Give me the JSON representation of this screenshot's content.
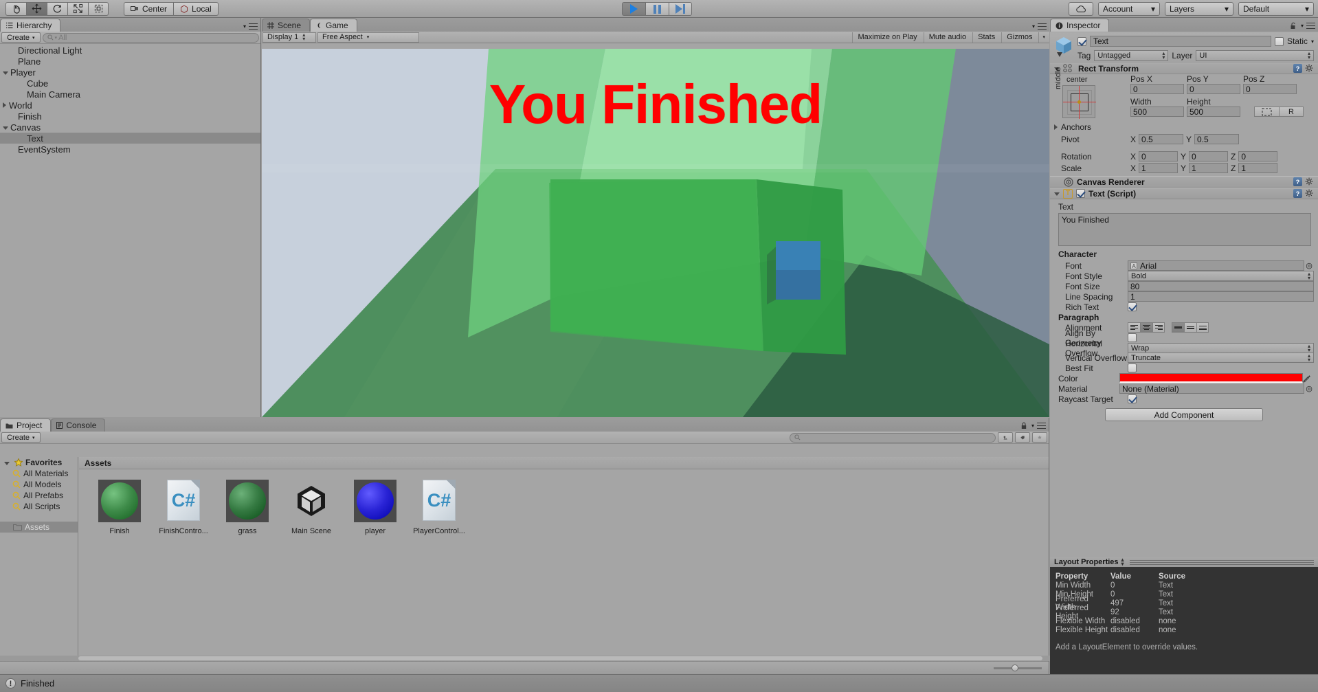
{
  "toolbar": {
    "tools": [
      {
        "name": "hand-tool",
        "icon": "hand",
        "active": false
      },
      {
        "name": "move-tool",
        "icon": "move",
        "active": true
      },
      {
        "name": "rotate-tool",
        "icon": "rotate",
        "active": false
      },
      {
        "name": "scale-tool",
        "icon": "scale",
        "active": false
      },
      {
        "name": "rect-tool",
        "icon": "rect",
        "active": false
      }
    ],
    "pivot_mode": "Center",
    "pivot_rotation": "Local",
    "play_label": "play",
    "pause_label": "pause",
    "step_label": "step",
    "cloud_label": "cloud",
    "account": "Account",
    "layers": "Layers",
    "layout": "Default"
  },
  "hierarchy": {
    "tab": "Hierarchy",
    "create_label": "Create",
    "search_placeholder": "All",
    "items": [
      {
        "label": "Directional Light",
        "depth": 1,
        "fold": "none",
        "selected": false
      },
      {
        "label": "Plane",
        "depth": 1,
        "fold": "none",
        "selected": false
      },
      {
        "label": "Player",
        "depth": 0,
        "fold": "down",
        "selected": false
      },
      {
        "label": "Cube",
        "depth": 2,
        "fold": "none",
        "selected": false
      },
      {
        "label": "Main Camera",
        "depth": 2,
        "fold": "none",
        "selected": false
      },
      {
        "label": "World",
        "depth": 0,
        "fold": "right",
        "selected": false
      },
      {
        "label": "Finish",
        "depth": 1,
        "fold": "none",
        "selected": false
      },
      {
        "label": "Canvas",
        "depth": 0,
        "fold": "down",
        "selected": false
      },
      {
        "label": "Text",
        "depth": 2,
        "fold": "none",
        "selected": true
      },
      {
        "label": "EventSystem",
        "depth": 1,
        "fold": "none",
        "selected": false
      }
    ]
  },
  "game": {
    "scene_tab": "Scene",
    "game_tab": "Game",
    "display": "Display 1",
    "aspect": "Free Aspect",
    "maximize_on_play": "Maximize on Play",
    "mute_audio": "Mute audio",
    "stats": "Stats",
    "gizmos": "Gizmos",
    "overlay_text": "You Finished",
    "overlay_color": "#ff0000",
    "sky_left_color": "#c7d0dc",
    "sky_right_color": "#7d8a9a",
    "ground_color": "#4e8f5e",
    "goal_color": "#3fae51",
    "player_color": "#3a7fbf"
  },
  "project": {
    "tab": "Project",
    "console_tab": "Console",
    "create_label": "Create",
    "search_placeholder": "",
    "favorites_label": "Favorites",
    "favorites": [
      "All Materials",
      "All Models",
      "All Prefabs",
      "All Scripts"
    ],
    "assets_root": "Assets",
    "breadcrumb": "Assets",
    "assets": [
      {
        "name": "Finish",
        "type": "material",
        "color": "#3f8c4a"
      },
      {
        "name": "FinishContro...",
        "type": "script"
      },
      {
        "name": "grass",
        "type": "material",
        "color": "#357a42"
      },
      {
        "name": "Main Scene",
        "type": "scene"
      },
      {
        "name": "player",
        "type": "material",
        "color": "#2a24d6"
      },
      {
        "name": "PlayerControl...",
        "type": "script"
      }
    ]
  },
  "inspector": {
    "tab": "Inspector",
    "object_name": "Text",
    "enabled": true,
    "static_label": "Static",
    "tag_label": "Tag",
    "tag_value": "Untagged",
    "layer_label": "Layer",
    "layer_value": "UI",
    "rect_transform": {
      "title": "Rect Transform",
      "anchor_preset_top": "center",
      "anchor_preset_side": "middle",
      "pos_x_label": "Pos X",
      "pos_x": "0",
      "pos_y_label": "Pos Y",
      "pos_y": "0",
      "pos_z_label": "Pos Z",
      "pos_z": "0",
      "width_label": "Width",
      "width": "500",
      "height_label": "Height",
      "height": "500",
      "blueprint_label": "R",
      "anchors_label": "Anchors",
      "pivot_label": "Pivot",
      "pivot_x": "0.5",
      "pivot_y": "0.5",
      "rotation_label": "Rotation",
      "rot_x": "0",
      "rot_y": "0",
      "rot_z": "0",
      "scale_label": "Scale",
      "scale_x": "1",
      "scale_y": "1",
      "scale_z": "1",
      "x": "X",
      "y": "Y",
      "z": "Z"
    },
    "canvas_renderer": {
      "title": "Canvas Renderer"
    },
    "text_script": {
      "title": "Text (Script)",
      "enabled": true,
      "text_label": "Text",
      "text_value": "You Finished",
      "character_label": "Character",
      "font_label": "Font",
      "font_value": "Arial",
      "font_style_label": "Font Style",
      "font_style_value": "Bold",
      "font_size_label": "Font Size",
      "font_size_value": "80",
      "line_spacing_label": "Line Spacing",
      "line_spacing_value": "1",
      "rich_text_label": "Rich Text",
      "rich_text_value": true,
      "paragraph_label": "Paragraph",
      "alignment_label": "Alignment",
      "alignment_h": "center",
      "alignment_v": "top",
      "align_by_geometry_label": "Align By Geometry",
      "align_by_geometry_value": false,
      "horizontal_overflow_label": "Horizontal Overflow",
      "horizontal_overflow_value": "Wrap",
      "vertical_overflow_label": "Vertical Overflow",
      "vertical_overflow_value": "Truncate",
      "best_fit_label": "Best Fit",
      "best_fit_value": false,
      "color_label": "Color",
      "color_value": "#ff0000",
      "material_label": "Material",
      "material_value": "None (Material)",
      "raycast_target_label": "Raycast Target",
      "raycast_target_value": true
    },
    "add_component": "Add Component"
  },
  "layout_properties": {
    "title": "Layout Properties",
    "columns": [
      "Property",
      "Value",
      "Source"
    ],
    "rows": [
      [
        "Min Width",
        "0",
        "Text"
      ],
      [
        "Min Height",
        "0",
        "Text"
      ],
      [
        "Preferred Width",
        "497",
        "Text"
      ],
      [
        "Preferred Height",
        "92",
        "Text"
      ],
      [
        "Flexible Width",
        "disabled",
        "none"
      ],
      [
        "Flexible Height",
        "disabled",
        "none"
      ]
    ],
    "note": "Add a LayoutElement to override values."
  },
  "status_bar": {
    "message": "Finished"
  }
}
